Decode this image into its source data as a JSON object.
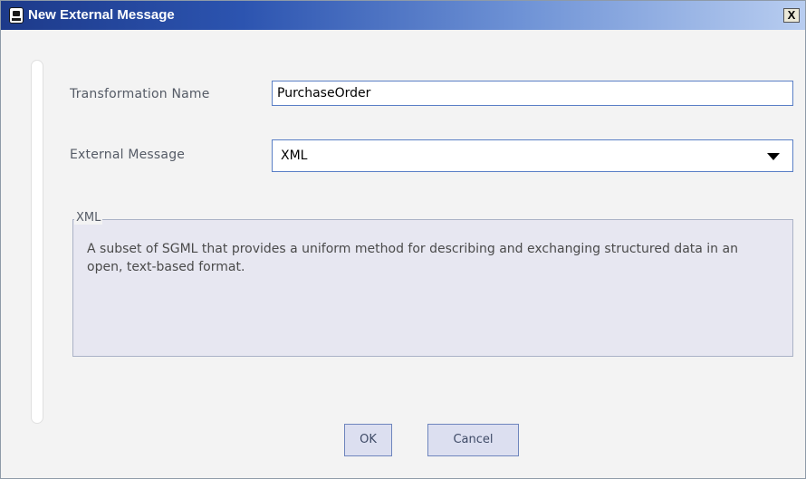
{
  "window": {
    "title": "New External Message",
    "close_label": "X"
  },
  "form": {
    "transformation_name_label": "Transformation Name",
    "transformation_name_value": "PurchaseOrder",
    "external_message_label": "External Message",
    "external_message_value": "XML"
  },
  "description": {
    "legend": "XML",
    "text": "A subset of SGML that provides a uniform method for describing and exchanging structured data in an open, text-based format."
  },
  "buttons": {
    "ok": "OK",
    "cancel": "Cancel"
  }
}
